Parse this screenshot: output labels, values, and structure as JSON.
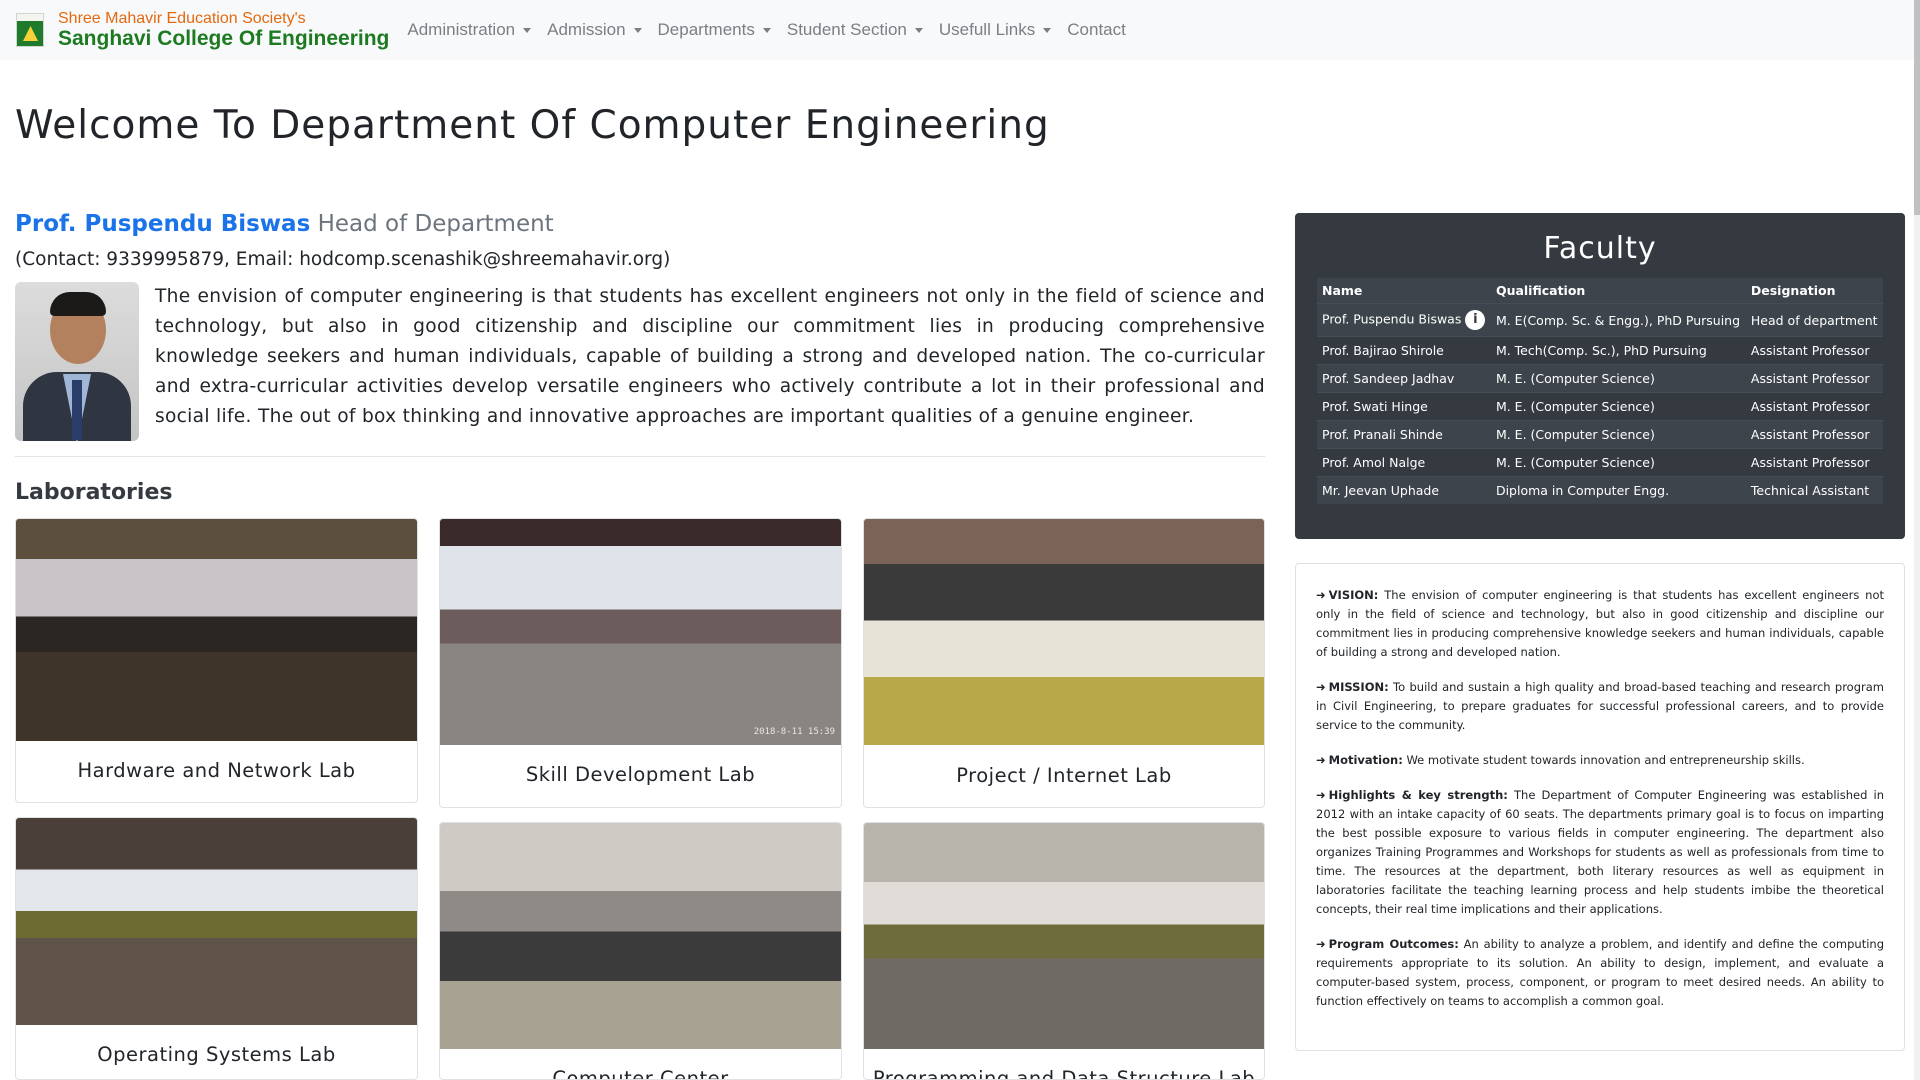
{
  "navbar": {
    "society": "Shree Mahavir Education Society's",
    "college": "Sanghavi College Of Engineering",
    "menu": [
      {
        "label": "Administration",
        "dropdown": true
      },
      {
        "label": "Admission",
        "dropdown": true
      },
      {
        "label": "Departments",
        "dropdown": true
      },
      {
        "label": "Student Section",
        "dropdown": true
      },
      {
        "label": "Usefull Links",
        "dropdown": true
      },
      {
        "label": "Contact",
        "dropdown": false
      }
    ]
  },
  "page": {
    "title": "Welcome To Department Of Computer Engineering",
    "hod_name": "Prof. Puspendu Biswas",
    "hod_role": "Head of Department",
    "contact": "(Contact: 9339995879, Email: hodcomp.scenashik@shreemahavir.org)",
    "intro": "The envision of computer engineering is that students has excellent engineers not only in the field of science and technology, but also in good citizenship and discipline our commitment lies in producing comprehensive knowledge seekers and human individuals, capable of building a strong and developed nation. The co-curricular and extra-curricular activities develop versatile engineers who actively contribute a lot in their professional and social life. The out of box thinking and innovative approaches are important qualities of a genuine engineer.",
    "labs_heading": "Laboratories"
  },
  "labs": [
    {
      "label": "Hardware and Network Lab"
    },
    {
      "label": "Skill Development Lab",
      "stamp": "2018-8-11 15:39"
    },
    {
      "label": "Project / Internet Lab"
    },
    {
      "label": "Operating Systems Lab"
    },
    {
      "label": "Computer Center"
    },
    {
      "label": "Programming and Data Structure Lab"
    }
  ],
  "faculty": {
    "heading": "Faculty",
    "columns": [
      "Name",
      "Qualification",
      "Designation"
    ],
    "rows": [
      [
        "Prof. Puspendu Biswas",
        "M. E(Comp. Sc. & Engg.), PhD Pursuing",
        "Head of department"
      ],
      [
        "Prof. Bajirao Shirole",
        "M. Tech(Comp. Sc.), PhD Pursuing",
        "Assistant Professor"
      ],
      [
        "Prof. Sandeep Jadhav",
        "M. E. (Computer Science)",
        "Assistant Professor"
      ],
      [
        "Prof. Swati Hinge",
        "M. E. (Computer Science)",
        "Assistant Professor"
      ],
      [
        "Prof. Pranali Shinde",
        "M. E. (Computer Science)",
        "Assistant Professor"
      ],
      [
        "Prof. Amol Nalge",
        "M. E. (Computer Science)",
        "Assistant Professor"
      ],
      [
        "Mr. Jeevan Uphade",
        "Diploma in Computer Engg.",
        "Technical Assistant"
      ]
    ]
  },
  "vision": [
    {
      "title": "VISION:",
      "text": "The envision of computer engineering is that students has excellent engineers not only in the field of science and technology, but also in good citizenship and discipline our commitment lies in producing comprehensive knowledge seekers and human individuals, capable of building a strong and developed nation."
    },
    {
      "title": "MISSION:",
      "text": "To build and sustain a high quality and broad-based teaching and research program in Civil Engineering, to prepare graduates for successful professional careers, and to provide service to the community."
    },
    {
      "title": "Motivation:",
      "text": "We motivate student towards innovation and entrepreneurship skills."
    },
    {
      "title": "Highlights & key strength:",
      "text": "The Department of Computer Engineering was established in 2012 with an intake capacity of 60 seats. The departments primary goal is to focus on imparting the best possible exposure to various fields in computer engineering. The department also organizes Training Programmes and Workshops for students as well as professionals from time to time. The resources at the department, both literary resources as well as equipment in laboratories facilitate the teaching learning process and help students imbibe the theoretical concepts, their real time implications and their applications."
    },
    {
      "title": "Program Outcomes:",
      "text": "An ability to analyze a problem, and identify and define the computing requirements appropriate to its solution. An ability to design, implement, and evaluate a computer-based system, process, component, or program to meet desired needs. An ability to function effectively on teams to accomplish a common goal."
    }
  ]
}
